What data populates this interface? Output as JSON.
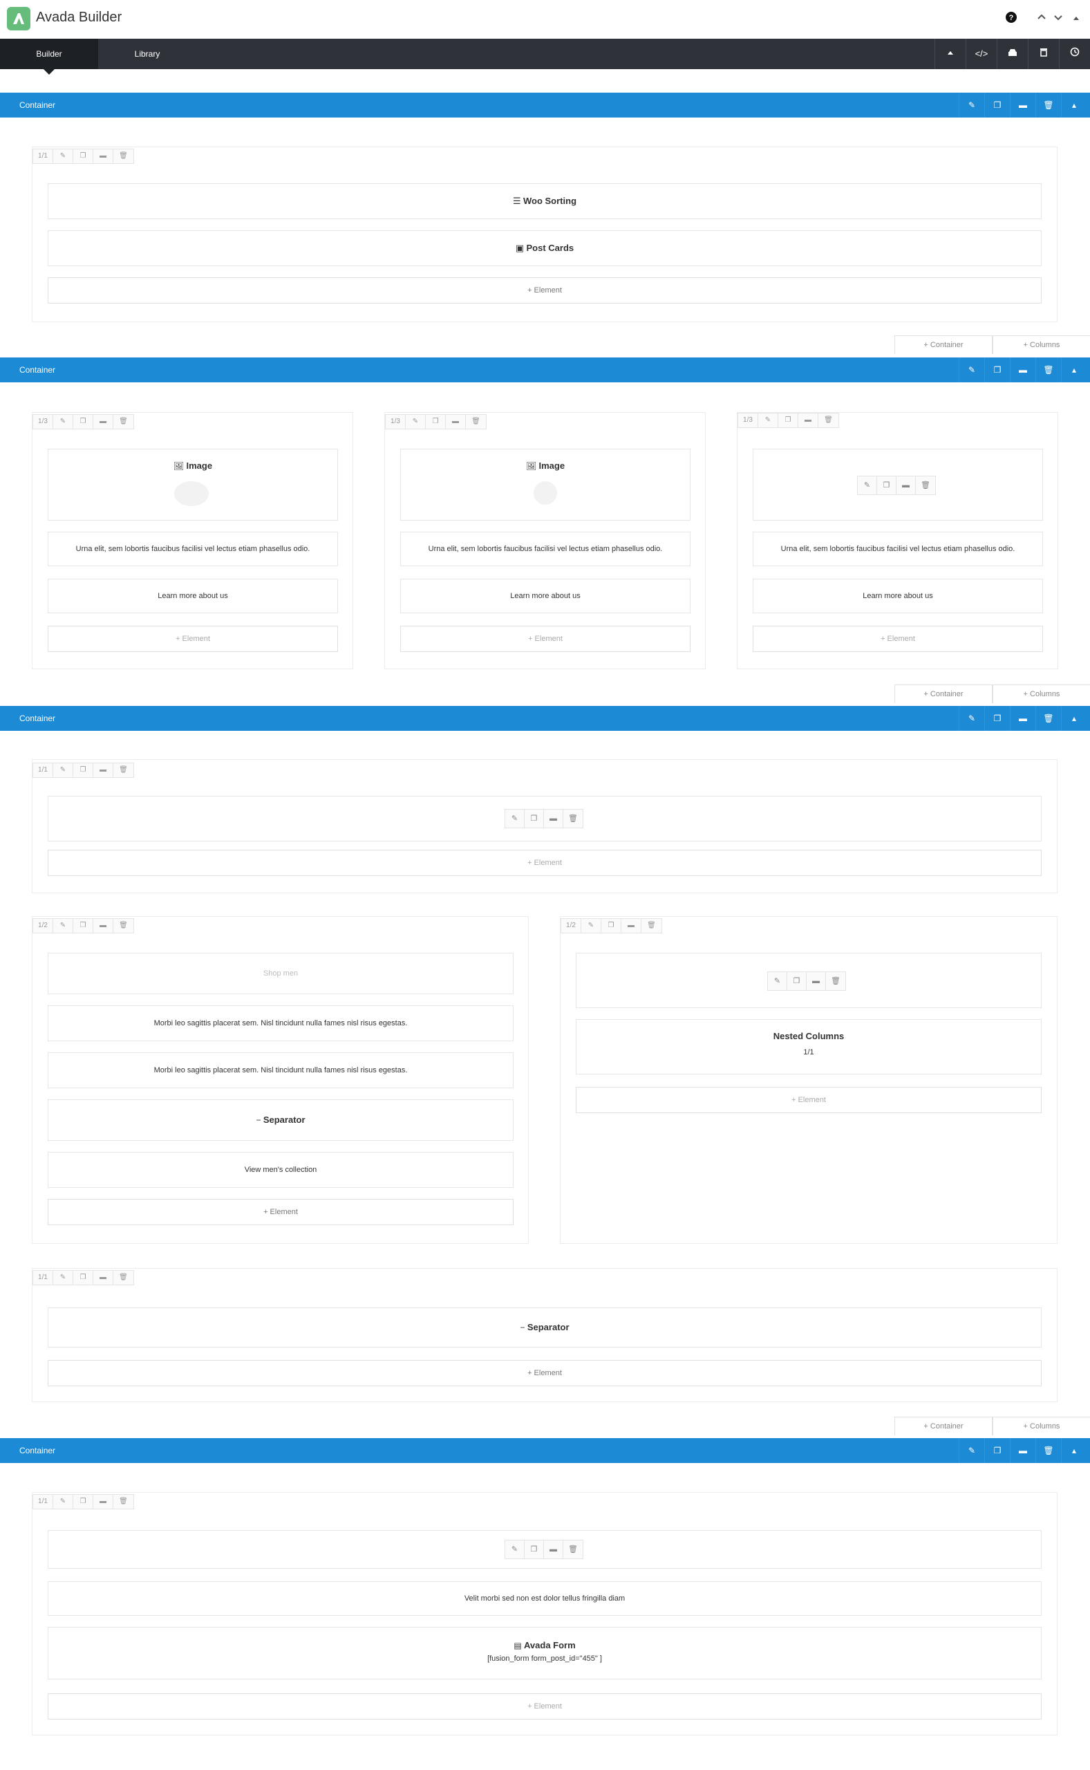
{
  "app": {
    "title": "Avada Builder",
    "brand_color": "#65bc7b"
  },
  "topbar": {
    "help_icon": "question-circle-icon",
    "up_icon": "chevron-up-icon",
    "down_icon": "chevron-down-icon",
    "collapse_icon": "caret-up-icon"
  },
  "tabs": {
    "builder": "Builder",
    "library": "Library"
  },
  "toolbar_icons": [
    "caret-up-icon",
    "code-icon",
    "save-icon",
    "trash-icon",
    "history-icon"
  ],
  "accent_color": "#1c8ad4",
  "container_label": "Container",
  "container_actions": [
    "edit-icon",
    "clone-icon",
    "save-icon",
    "trash-icon",
    "collapse-icon"
  ],
  "add": {
    "container": "+ Container",
    "columns": "+ Columns",
    "element": "+ Element"
  },
  "containers": [
    {
      "label": "Container",
      "columns": [
        {
          "size": "1/1",
          "elements": [
            {
              "icon": "sort-icon",
              "title": "Woo Sorting"
            },
            {
              "icon": "post-cards-icon",
              "title": "Post Cards"
            }
          ]
        }
      ]
    },
    {
      "label": "Container",
      "columns": [
        {
          "size": "1/3",
          "elements": [
            {
              "icon": "image-icon",
              "title": "Image"
            },
            {
              "text": "Urna elit, sem lobortis faucibus facilisi vel lectus etiam phasellus odio."
            },
            {
              "text": "Learn more about us"
            }
          ]
        },
        {
          "size": "1/3",
          "elements": [
            {
              "icon": "image-icon",
              "title": "Image"
            },
            {
              "text": "Urna elit, sem lobortis faucibus facilisi vel lectus etiam phasellus odio."
            },
            {
              "text": "Learn more about us"
            }
          ]
        },
        {
          "size": "1/3",
          "elements": [
            {
              "text": "Urna elit, sem lobortis faucibus facilisi vel lectus etiam phasellus odio."
            },
            {
              "text": "Learn more about us"
            }
          ]
        }
      ]
    },
    {
      "label": "Container",
      "columns": [
        {
          "size": "1/1"
        },
        {
          "size": "1/2",
          "elements": [
            {
              "text": "Shop men"
            },
            {
              "text": "Morbi leo sagittis placerat sem. Nisl tincidunt nulla fames nisl risus egestas."
            },
            {
              "text": "Morbi leo sagittis placerat sem. Nisl tincidunt nulla fames nisl risus egestas."
            },
            {
              "icon": "separator-icon",
              "title": "Separator"
            },
            {
              "text": "View men's collection"
            }
          ]
        },
        {
          "size": "1/2",
          "elements": [
            {
              "title": "Nested Columns",
              "sub": "1/1"
            }
          ]
        },
        {
          "size": "1/1",
          "elements": [
            {
              "icon": "separator-icon",
              "title": "Separator"
            }
          ]
        }
      ]
    },
    {
      "label": "Container",
      "columns": [
        {
          "size": "1/1",
          "elements": [
            {
              "text": "Velit morbi sed non est dolor tellus fringilla diam"
            },
            {
              "icon": "form-icon",
              "title": "Avada Form",
              "sub": "[fusion_form form_post_id=\"455\" ]"
            }
          ]
        }
      ]
    }
  ]
}
